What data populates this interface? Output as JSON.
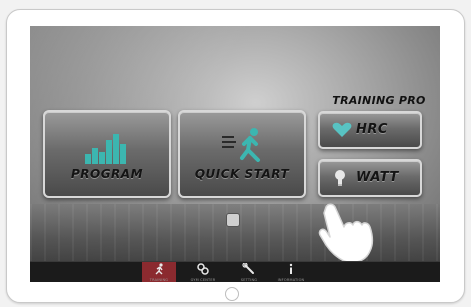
{
  "main": {
    "program_label": "Program",
    "quick_start_label": "Quick Start",
    "training_pro_title": "Training Pro",
    "hrc_label": "HRC",
    "watt_label": "WATT"
  },
  "navbar": {
    "items": [
      {
        "label": "Training"
      },
      {
        "label": "Gym Center"
      },
      {
        "label": "Setting"
      },
      {
        "label": "Information"
      }
    ]
  },
  "colors": {
    "heart_icon": "#58c3c3",
    "runner_icon": "#3cb6b0",
    "active_nav": "#8b2a2f"
  }
}
